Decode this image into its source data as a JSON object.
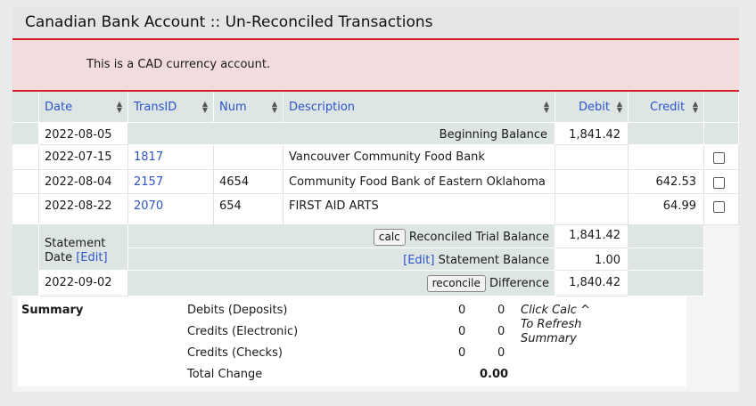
{
  "header": {
    "title": "Canadian Bank Account :: Un-Reconciled Transactions"
  },
  "notice": {
    "text": "This is a CAD currency account."
  },
  "columns": {
    "date": "Date",
    "transid": "TransID",
    "num": "Num",
    "description": "Description",
    "debit": "Debit",
    "credit": "Credit"
  },
  "icons": {
    "sort": "sort-icon",
    "checkbox": "checkbox-icon"
  },
  "beginning": {
    "date": "2022-08-05",
    "label": "Beginning Balance",
    "debit": "1,841.42"
  },
  "transactions": [
    {
      "date": "2022-07-15",
      "transid": "1817",
      "num": "",
      "description": "Vancouver Community Food Bank",
      "debit": "",
      "credit": ""
    },
    {
      "date": "2022-08-04",
      "transid": "2157",
      "num": "4654",
      "description": "Community Food Bank of Eastern Oklahoma",
      "debit": "",
      "credit": "642.53"
    },
    {
      "date": "2022-08-22",
      "transid": "2070",
      "num": "654",
      "description": "FIRST AID ARTS",
      "debit": "",
      "credit": "64.99"
    }
  ],
  "reconcile": {
    "statement_label": "Statement",
    "date_label": "Date",
    "edit_label": "[Edit]",
    "statement_date": "2022-09-02",
    "calc_button": "calc",
    "trial_balance_label": "Reconciled Trial Balance",
    "trial_balance_value": "1,841.42",
    "statement_balance_label": "Statement Balance",
    "statement_balance_value": "1.00",
    "reconcile_button": "reconcile",
    "difference_label": "Difference",
    "difference_value": "1,840.42"
  },
  "summary": {
    "title": "Summary",
    "rows": [
      {
        "label": "Debits (Deposits)",
        "a": "0",
        "b": "0"
      },
      {
        "label": "Credits (Electronic)",
        "a": "0",
        "b": "0"
      },
      {
        "label": "Credits (Checks)",
        "a": "0",
        "b": "0"
      }
    ],
    "total_label": "Total Change",
    "total_value": "0.00",
    "hint_line1": "Click Calc ^",
    "hint_line2": "To Refresh",
    "hint_line3": "Summary"
  }
}
